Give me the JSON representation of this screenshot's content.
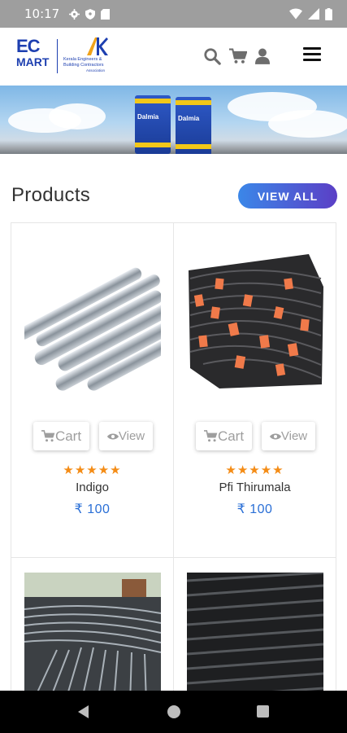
{
  "status_bar": {
    "time": "10:17",
    "left_icons": [
      "gear-icon",
      "shield-icon",
      "sd-card-icon"
    ],
    "right_icons": [
      "wifi-icon",
      "signal-icon",
      "battery-icon"
    ]
  },
  "header": {
    "logo_line1": "EC",
    "logo_line2": "MART",
    "association_line1": "Kerala Engineers &",
    "association_line2": "Building Contractors",
    "association_line3": "Association",
    "icons": [
      "search-icon",
      "cart-icon",
      "user-icon",
      "menu-icon"
    ]
  },
  "banner": {
    "brand_text": "Dalmia"
  },
  "products_section": {
    "title": "Products",
    "view_all_label": "VIEW ALL",
    "items": [
      {
        "name": "Indigo",
        "price": "₹ 100",
        "rating": 5,
        "stars": "★★★★★",
        "cart_label": "Cart",
        "view_label": "View"
      },
      {
        "name": "Pfi Thirumala",
        "price": "₹ 100",
        "rating": 5,
        "stars": "★★★★★",
        "cart_label": "Cart",
        "view_label": "View"
      }
    ]
  },
  "colors": {
    "brand_blue": "#1d3fb0",
    "star_orange": "#f48c16",
    "price_blue": "#2a6fd6",
    "button_gradient_start": "#3b87e8",
    "button_gradient_end": "#5b3fc6"
  },
  "nav_bar": {
    "icons": [
      "back-icon",
      "home-icon",
      "recents-icon"
    ]
  }
}
